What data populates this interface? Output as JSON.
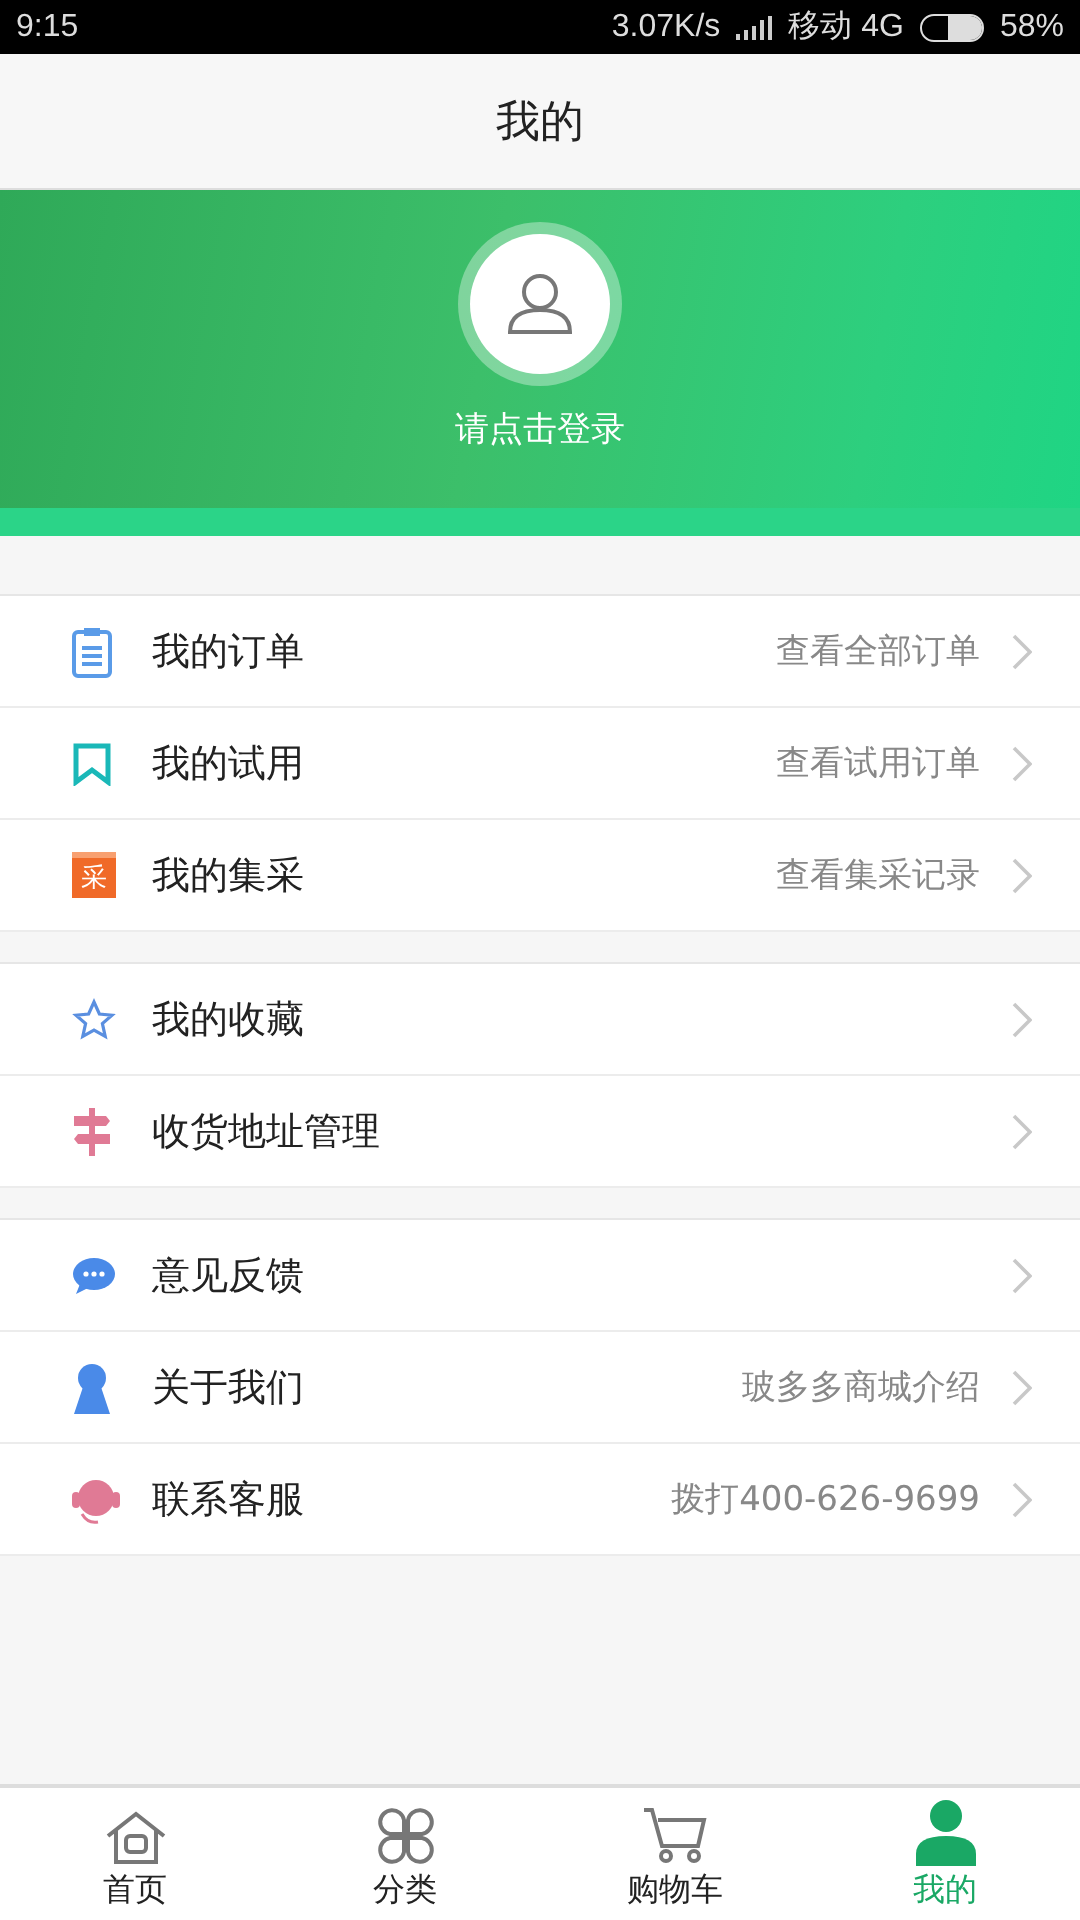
{
  "status_bar": {
    "time": "9:15",
    "speed": "3.07K/s",
    "carrier": "移动 4G",
    "battery": "58%"
  },
  "header": {
    "title": "我的"
  },
  "profile": {
    "login_prompt": "请点击登录"
  },
  "sections": [
    {
      "items": [
        {
          "kind": "clipboard",
          "label": "我的订单",
          "detail": "查看全部订单"
        },
        {
          "kind": "bookmark",
          "label": "我的试用",
          "detail": "查看试用订单"
        },
        {
          "kind": "badge",
          "badge_text": "采",
          "label": "我的集采",
          "detail": "查看集采记录"
        }
      ]
    },
    {
      "items": [
        {
          "kind": "star",
          "label": "我的收藏"
        },
        {
          "kind": "signpost",
          "label": "收货地址管理"
        }
      ]
    },
    {
      "items": [
        {
          "kind": "chat",
          "label": "意见反馈"
        },
        {
          "kind": "keyhole",
          "label": "关于我们",
          "detail": "玻多多商城介绍"
        },
        {
          "kind": "headset",
          "label": "联系客服",
          "detail": "拨打400-626-9699"
        }
      ]
    }
  ],
  "tab_bar": [
    {
      "kind": "home",
      "label": "首页",
      "selected": false
    },
    {
      "kind": "grid",
      "label": "分类",
      "selected": false
    },
    {
      "kind": "cart",
      "label": "购物车",
      "selected": false
    },
    {
      "kind": "person",
      "label": "我的",
      "selected": true
    }
  ]
}
